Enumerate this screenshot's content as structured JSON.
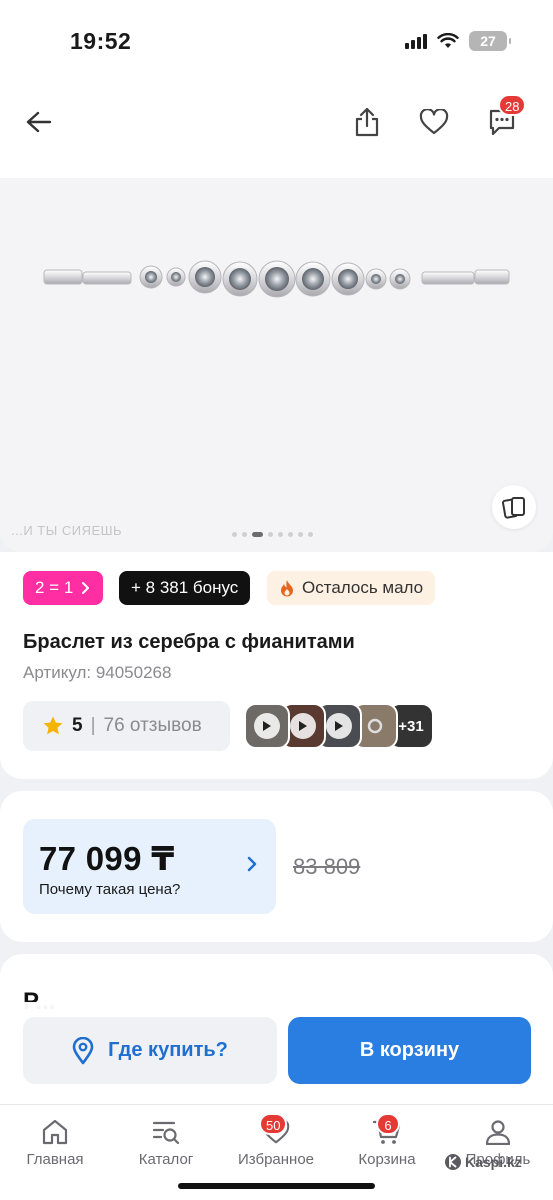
{
  "status": {
    "time": "19:52",
    "battery": "27"
  },
  "header": {
    "notifications_count": "28"
  },
  "gallery": {
    "watermark": "...И ТЫ СИЯЕШЬ",
    "dots_total": 8,
    "dots_active_index": 2
  },
  "chips": {
    "promo": "2 = 1",
    "bonus": "+ 8 381 бонус",
    "stock": "Осталось мало"
  },
  "product": {
    "title": "Браслет из серебра с фианитами",
    "sku": "Артикул: 94050268",
    "rating": "5",
    "rating_separator": "|",
    "reviews": "76 отзывов",
    "media_more": "+31"
  },
  "price": {
    "current": "77 099 ₸",
    "why_label": "Почему такая цена?",
    "old": "83 809"
  },
  "next_section": {
    "title": "Р..."
  },
  "actions": {
    "where_to_buy": "Где купить?",
    "add_to_cart": "В корзину"
  },
  "tabs": [
    {
      "label": "Главная"
    },
    {
      "label": "Каталог"
    },
    {
      "label": "Избранное",
      "badge": "50"
    },
    {
      "label": "Корзина",
      "badge": "6"
    },
    {
      "label": "Профиль"
    }
  ],
  "brand": {
    "logo_text": "Kaspi.kz"
  },
  "colors": {
    "accent_blue": "#2a7de1",
    "promo_pink": "#ff2fa3",
    "badge_red": "#e53935",
    "price_box": "#e7f1fd"
  }
}
